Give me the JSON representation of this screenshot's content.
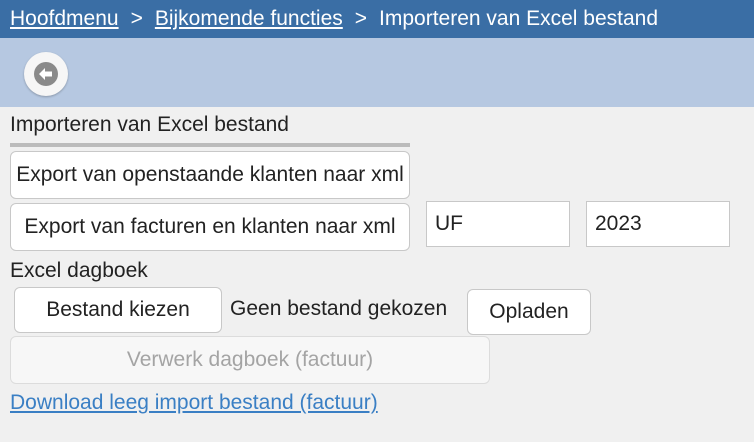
{
  "breadcrumb": {
    "home": "Hoofdmenu",
    "separator": ">",
    "extra_functions": "Bijkomende functies",
    "current": "Importeren van Excel bestand"
  },
  "toolbar": {
    "back_icon": "arrow-left-icon"
  },
  "section": {
    "title": "Importeren van Excel bestand"
  },
  "exports": {
    "open_customers": "Export van openstaande klanten naar xml",
    "invoices_customers": "Export van facturen en klanten naar xml",
    "journal_code": "UF",
    "year": "2023"
  },
  "excel": {
    "label": "Excel dagboek",
    "choose_file": "Bestand kiezen",
    "no_file": "Geen bestand gekozen",
    "upload": "Opladen",
    "process": "Verwerk dagboek (factuur)",
    "download_link": "Download leeg import bestand (factuur)"
  },
  "colors": {
    "header_bg": "#3a6ea5",
    "toolbar_bg": "#b6c8e1",
    "link": "#3a7fc4"
  }
}
